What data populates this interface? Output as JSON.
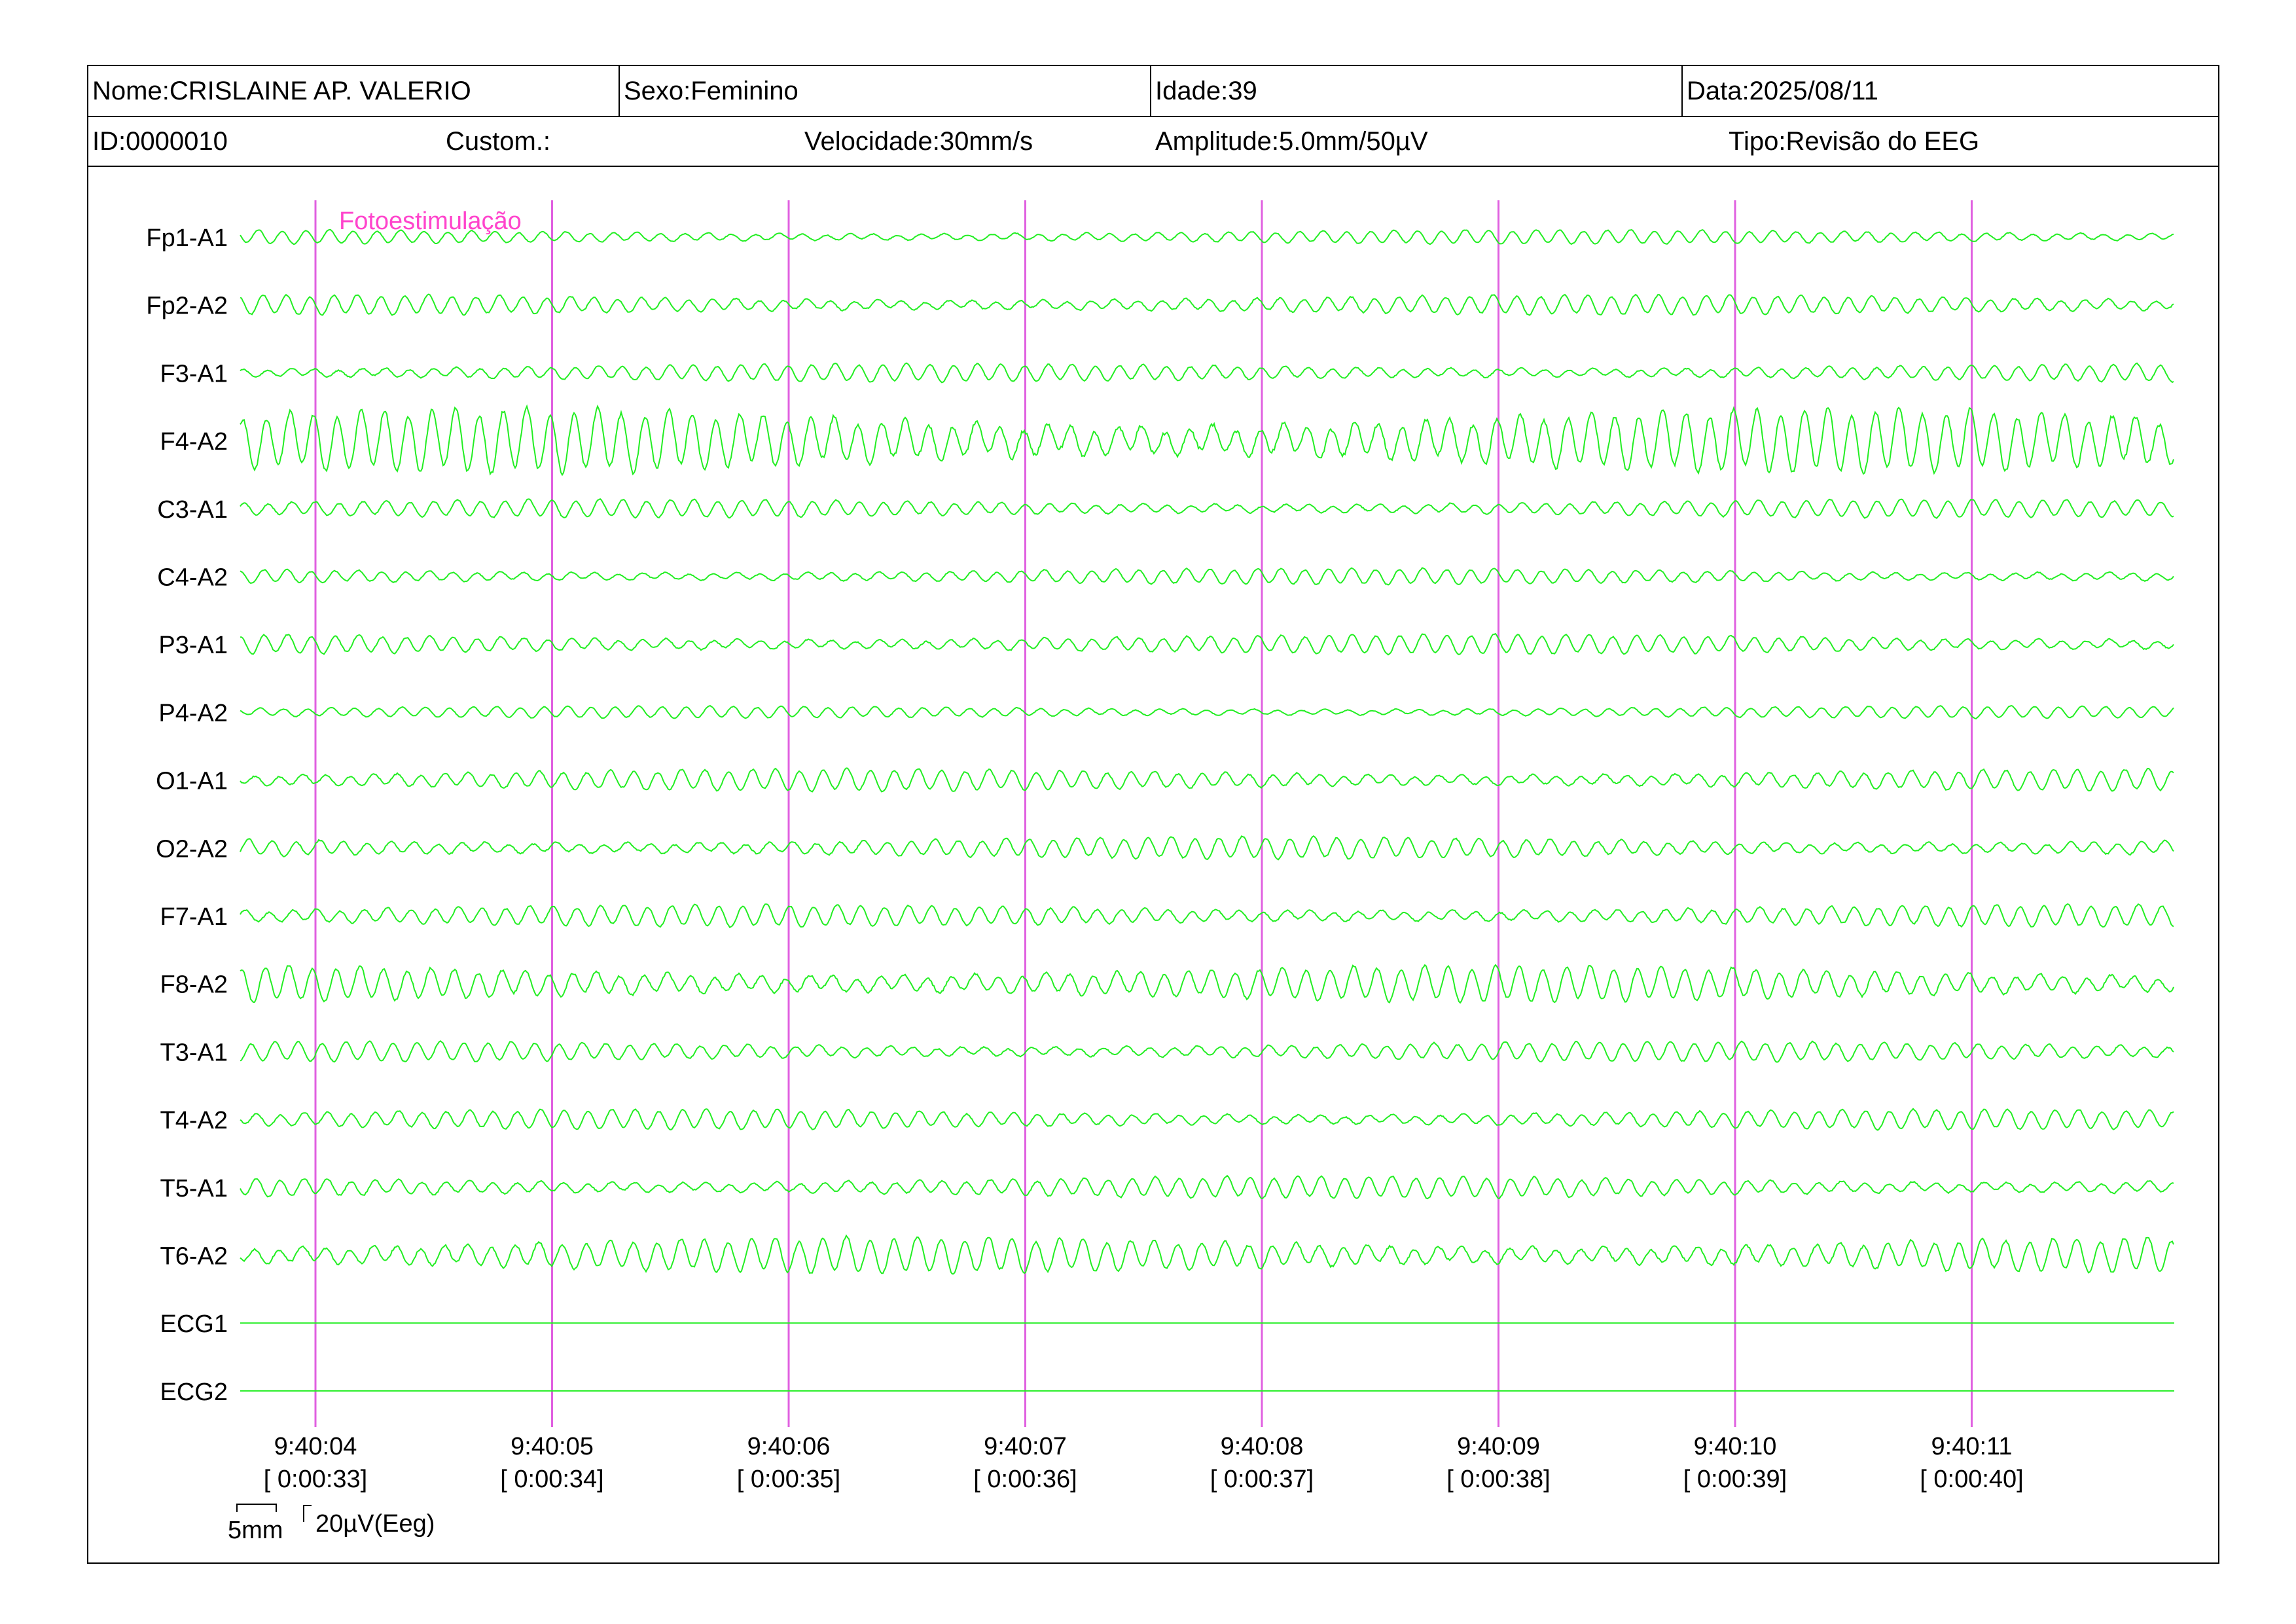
{
  "header": {
    "nome": "Nome:CRISLAINE AP. VALERIO",
    "sexo": "Sexo:Feminino",
    "idade": "Idade:39",
    "data": "Data:2025/08/11",
    "id": "ID:0000010",
    "custom": "Custom.:",
    "velocidade": "Velocidade:30mm/s",
    "amplitude": "Amplitude:5.0mm/50µV",
    "tipo": "Tipo:Revisão do EEG"
  },
  "annotation": "Fotoestimulação",
  "scale": {
    "time_label": "5mm",
    "amp_label": "20µV(Eeg)"
  },
  "colors": {
    "trace": "#22ee22",
    "marker": "#e060e0",
    "annotation": "#ff44cc"
  },
  "chart_data": {
    "type": "line",
    "channels": [
      "Fp1-A1",
      "Fp2-A2",
      "F3-A1",
      "F4-A2",
      "C3-A1",
      "C4-A2",
      "P3-A1",
      "P4-A2",
      "O1-A1",
      "O2-A2",
      "F7-A1",
      "F8-A2",
      "T3-A1",
      "T4-A2",
      "T5-A1",
      "T6-A2",
      "ECG1",
      "ECG2"
    ],
    "time_markers": [
      {
        "clock": "9:40:04",
        "elapsed": "[ 0:00:33]"
      },
      {
        "clock": "9:40:05",
        "elapsed": "[ 0:00:34]"
      },
      {
        "clock": "9:40:06",
        "elapsed": "[ 0:00:35]"
      },
      {
        "clock": "9:40:07",
        "elapsed": "[ 0:00:36]"
      },
      {
        "clock": "9:40:08",
        "elapsed": "[ 0:00:37]"
      },
      {
        "clock": "9:40:09",
        "elapsed": "[ 0:00:38]"
      },
      {
        "clock": "9:40:10",
        "elapsed": "[ 0:00:39]"
      },
      {
        "clock": "9:40:11",
        "elapsed": "[ 0:00:40]"
      }
    ],
    "xlim_seconds": [
      -0.32,
      7.85
    ],
    "dominant_frequency_hz": 10,
    "relative_amplitude": [
      0.35,
      0.5,
      0.45,
      1.6,
      0.45,
      0.4,
      0.5,
      0.3,
      0.55,
      0.55,
      0.55,
      0.9,
      0.5,
      0.5,
      0.55,
      0.9,
      0,
      0
    ],
    "grid": false
  }
}
